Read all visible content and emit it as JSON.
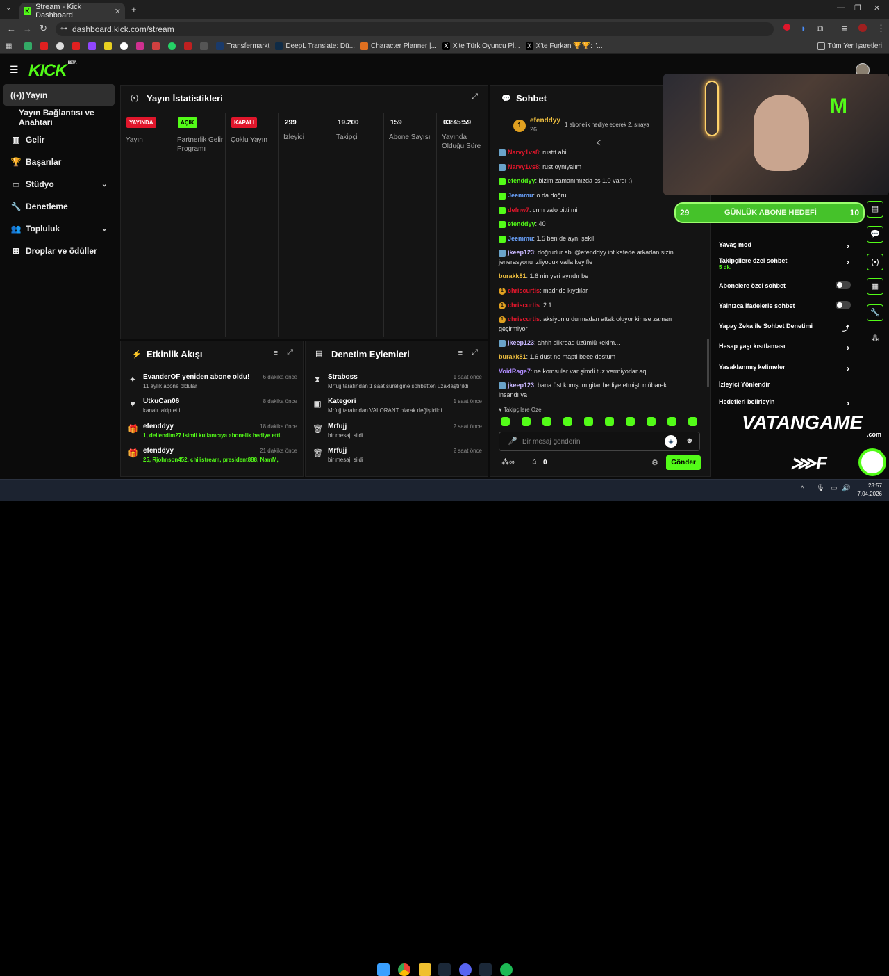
{
  "browser": {
    "tab_title": "Stream - Kick Dashboard",
    "url": "dashboard.kick.com/stream",
    "bookmarks": [
      "Transfermarkt",
      "DeepL Translate: Dü...",
      "Character Planner |...",
      "X'te Türk Oyuncu Pl...",
      "X'te Furkan 🏆🏆: \"..."
    ],
    "all_bookmarks": "Tüm Yer İşaretleri"
  },
  "brand": {
    "logo": "KICK",
    "beta": "BETA",
    "accent": "#53fc18"
  },
  "sidebar": {
    "items": [
      {
        "label": "Yayın",
        "icon": "broadcast-icon"
      },
      {
        "label": "Yayın Bağlantısı ve Anahtarı",
        "icon": ""
      },
      {
        "label": "Gelir",
        "icon": "chart-icon"
      },
      {
        "label": "Başarılar",
        "icon": "trophy-icon"
      },
      {
        "label": "Stüdyo",
        "icon": "studio-icon"
      },
      {
        "label": "Denetleme",
        "icon": "wrench-icon"
      },
      {
        "label": "Topluluk",
        "icon": "people-icon"
      },
      {
        "label": "Droplar ve ödüller",
        "icon": "drops-icon"
      }
    ]
  },
  "stats": {
    "title": "Yayın İstatistikleri",
    "cols": [
      {
        "badge": "YAYINDA",
        "badge_color": "#e0162b",
        "label": "Yayın"
      },
      {
        "badge": "AÇIK",
        "badge_color": "#53fc18",
        "label": "Partnerlik Gelir Programı"
      },
      {
        "badge": "KAPALI",
        "badge_color": "#e0162b",
        "label": "Çoklu Yayın"
      },
      {
        "value": "299",
        "label": "İzleyici"
      },
      {
        "value": "19.200",
        "label": "Takipçi"
      },
      {
        "value": "159",
        "label": "Abone Sayısı"
      },
      {
        "value": "03:45:59",
        "label": "Yayında Olduğu Süre"
      }
    ]
  },
  "activity": {
    "title": "Etkinlik Akışı",
    "items": [
      {
        "name": "EvanderOF yeniden abone oldu!",
        "sub": "11 aylık abone oldular",
        "time": "6 dakika önce",
        "icon": "sparkle-icon"
      },
      {
        "name": "UtkuCan06",
        "sub": "kanalı takip etti",
        "time": "8 dakika önce",
        "icon": "heart-icon"
      },
      {
        "name": "efenddyy",
        "sub": "1, dellendim27 isimli kullanıcıya abonelik hediye etti.",
        "time": "18 dakika önce",
        "icon": "gift-icon"
      },
      {
        "name": "efenddyy",
        "sub": "25, Rjohnson452, chilistream, president888, NamM,",
        "time": "21 dakika önce",
        "icon": "gift-icon"
      }
    ]
  },
  "moderation": {
    "title": "Denetim Eylemleri",
    "items": [
      {
        "name": "Straboss",
        "sub": "Mrfujj tarafından 1 saat süreliğine sohbetten uzaklaştırıldı",
        "time": "1 saat önce",
        "icon": "hourglass-icon"
      },
      {
        "name": "Kategori",
        "sub": "Mrfujj tarafından VALORANT olarak değiştirildi",
        "time": "1 saat önce",
        "icon": "category-icon"
      },
      {
        "name": "Mrfujj",
        "sub": "bir mesajı sildi",
        "time": "2 saat önce",
        "icon": "trash-icon"
      },
      {
        "name": "Mrfujj",
        "sub": "bir mesajı sildi",
        "time": "2 saat önce",
        "icon": "trash-icon"
      }
    ]
  },
  "chat": {
    "title": "Sohbet",
    "pinned_user": "efenddyy",
    "pinned_count": "26",
    "pinned_rank": "1",
    "pinned_text": "1 abonelik hediye ederek 2. sıraya",
    "messages": [
      {
        "user": "Narvy1vs8",
        "text": "rusttt abi",
        "color": "#e0162b",
        "badge": "mod"
      },
      {
        "user": "Narvy1vs8",
        "text": "rust oynıyalım",
        "color": "#e0162b",
        "badge": "mod"
      },
      {
        "user": "efenddyy",
        "text": "bizim zamanımızda cs 1.0 vardı :)",
        "color": "#53fc18",
        "badge": "sub"
      },
      {
        "user": "Jeemmu",
        "text": "o da doğru",
        "color": "#6aa3ff",
        "badge": "sub"
      },
      {
        "user": "defnw7",
        "text": "cnm valo bitti mi",
        "color": "#e0162b",
        "badge": "sub"
      },
      {
        "user": "efenddyy",
        "text": "40",
        "color": "#53fc18",
        "badge": "sub"
      },
      {
        "user": "Jeemmu",
        "text": "1.5 ben de aynı şekil",
        "color": "#6aa3ff",
        "badge": "sub"
      },
      {
        "user": "jkeep123",
        "text": "doğrudur abi @efenddyy int kafede arkadan sizin jenerasyonu izliyoduk valla keyifle",
        "color": "#c9b8ff",
        "badge": "mod"
      },
      {
        "user": "burakk81",
        "text": "1.6 nin yeri ayrıdır be",
        "color": "#f0c040",
        "badge": ""
      },
      {
        "user": "chriscurtis",
        "text": "madride kıydılar",
        "color": "#e0162b",
        "badge": "gift"
      },
      {
        "user": "chriscurtis",
        "text": "2 1",
        "color": "#e0162b",
        "badge": "gift"
      },
      {
        "user": "chriscurtis",
        "text": "aksiyonlu durmadan attak oluyor kimse zaman geçirmiyor",
        "color": "#e0162b",
        "badge": "gift"
      },
      {
        "user": "jkeep123",
        "text": "ahhh silkroad üzümlü kekim...",
        "color": "#c9b8ff",
        "badge": "mod"
      },
      {
        "user": "burakk81",
        "text": "1.6 dust ne mapti beee dostum",
        "color": "#f0c040",
        "badge": ""
      },
      {
        "user": "VoidRage7",
        "text": "ne komsular var şimdi tuz vermiyorlar aq",
        "color": "#b08cff",
        "badge": ""
      },
      {
        "user": "jkeep123",
        "text": "bana üst komşum gitar hediye etmişti mübarek insandı ya",
        "color": "#c9b8ff",
        "badge": "mod"
      }
    ],
    "followers_only": "Takipçilere Özel",
    "input_placeholder": "Bir mesaj gönderin",
    "send": "Gönder",
    "count": "0"
  },
  "overlay": {
    "goal_label": "GÜNLÜK ABONE HEDEFİ",
    "goal_current": "29",
    "goal_target": "10",
    "brand": "VATANGAME",
    "brand_sub": ".com"
  },
  "settings": {
    "items": [
      {
        "label": "Yavaş mod",
        "type": "arrow"
      },
      {
        "label": "Takipçilere özel sohbet",
        "sub": "5 dk.",
        "type": "arrow"
      },
      {
        "label": "Abonelere özel sohbet",
        "type": "toggle"
      },
      {
        "label": "Yalnızca ifadelerle sohbet",
        "type": "toggle"
      },
      {
        "label": "Yapay Zeka ile Sohbet Denetimi",
        "type": "external"
      },
      {
        "label": "Hesap yaşı kısıtlaması",
        "type": "arrow"
      },
      {
        "label": "Yasaklanmış kelimeler",
        "type": "arrow"
      },
      {
        "label": "İzleyici Yönlendir",
        "type": "none"
      },
      {
        "label": "Hedefleri belirleyin",
        "type": "arrow"
      }
    ]
  },
  "taskbar": {
    "time": "23:57",
    "date": "7.04.2026"
  }
}
